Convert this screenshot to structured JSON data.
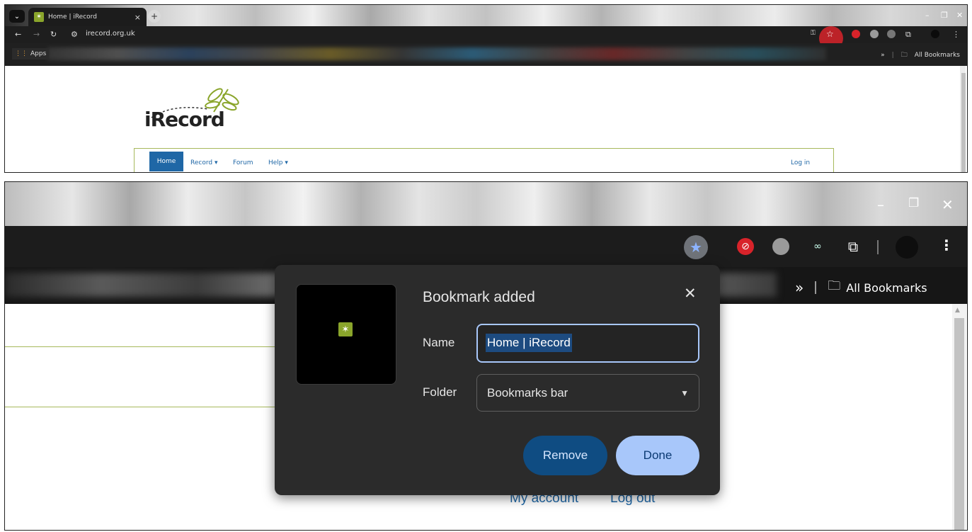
{
  "top": {
    "tab_title": "Home | iRecord",
    "url": "irecord.org.uk",
    "apps_label": "Apps",
    "all_bookmarks": "All Bookmarks",
    "bm_chevron": "»",
    "logo_text": "iRecord",
    "nav": {
      "home": "Home",
      "record": "Record ▾",
      "forum": "Forum",
      "help": "Help ▾",
      "login": "Log in"
    }
  },
  "bottom": {
    "all_bookmarks": "All Bookmarks",
    "bm_chevron": "»",
    "my_account": "My account",
    "log_out": "Log out"
  },
  "dialog": {
    "title": "Bookmark added",
    "name_label": "Name",
    "name_value": "Home | iRecord",
    "folder_label": "Folder",
    "folder_value": "Bookmarks bar",
    "remove_label": "Remove",
    "done_label": "Done"
  },
  "colors": {
    "accent_blue": "#a8c7fa",
    "remove_blue": "#0f4c82",
    "site_blue": "#1f67a6",
    "site_green": "#a7b95c",
    "star_highlight": "#d8232a"
  }
}
